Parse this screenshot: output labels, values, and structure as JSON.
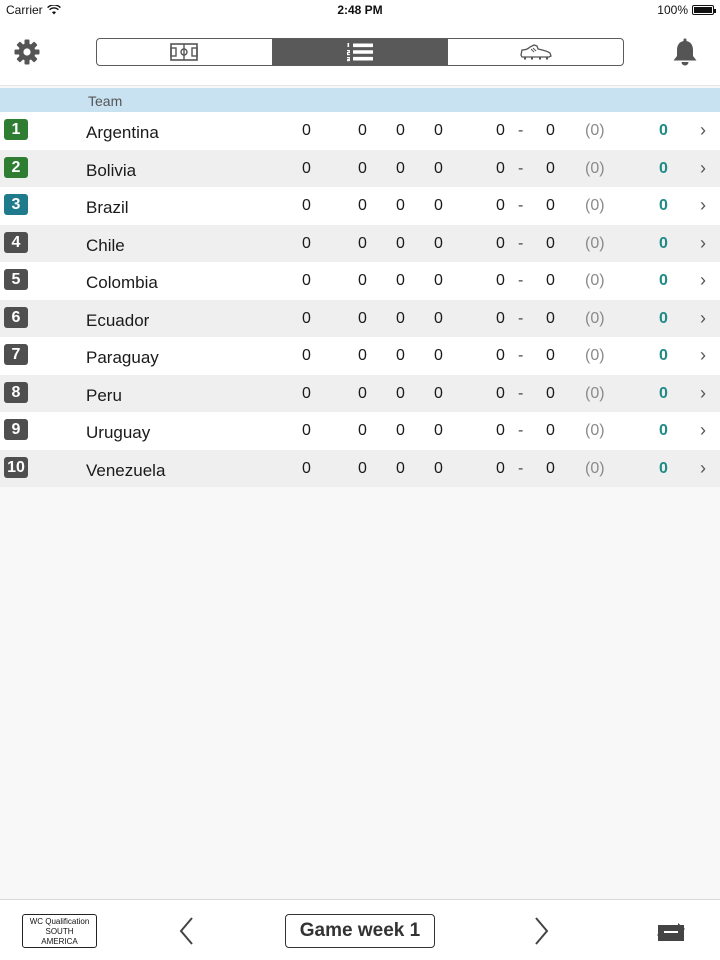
{
  "status_bar": {
    "carrier": "Carrier",
    "time": "2:48 PM",
    "battery": "100%"
  },
  "top_bar": {
    "settings_icon": "gear-icon",
    "notifications_icon": "bell-icon",
    "segments": [
      {
        "icon": "pitch-icon",
        "selected": false
      },
      {
        "icon": "ranked-list-icon",
        "selected": true
      },
      {
        "icon": "football-boot-icon",
        "selected": false
      }
    ]
  },
  "table": {
    "header_team": "Team",
    "rows": [
      {
        "rank": "1",
        "team": "Argentina",
        "played": "0",
        "won": "0",
        "drawn": "0",
        "lost": "0",
        "gf": "0",
        "dash": "-",
        "ga": "0",
        "gd": "(0)",
        "points": "0"
      },
      {
        "rank": "2",
        "team": "Bolivia",
        "played": "0",
        "won": "0",
        "drawn": "0",
        "lost": "0",
        "gf": "0",
        "dash": "-",
        "ga": "0",
        "gd": "(0)",
        "points": "0"
      },
      {
        "rank": "3",
        "team": "Brazil",
        "played": "0",
        "won": "0",
        "drawn": "0",
        "lost": "0",
        "gf": "0",
        "dash": "-",
        "ga": "0",
        "gd": "(0)",
        "points": "0"
      },
      {
        "rank": "4",
        "team": "Chile",
        "played": "0",
        "won": "0",
        "drawn": "0",
        "lost": "0",
        "gf": "0",
        "dash": "-",
        "ga": "0",
        "gd": "(0)",
        "points": "0"
      },
      {
        "rank": "5",
        "team": "Colombia",
        "played": "0",
        "won": "0",
        "drawn": "0",
        "lost": "0",
        "gf": "0",
        "dash": "-",
        "ga": "0",
        "gd": "(0)",
        "points": "0"
      },
      {
        "rank": "6",
        "team": "Ecuador",
        "played": "0",
        "won": "0",
        "drawn": "0",
        "lost": "0",
        "gf": "0",
        "dash": "-",
        "ga": "0",
        "gd": "(0)",
        "points": "0"
      },
      {
        "rank": "7",
        "team": "Paraguay",
        "played": "0",
        "won": "0",
        "drawn": "0",
        "lost": "0",
        "gf": "0",
        "dash": "-",
        "ga": "0",
        "gd": "(0)",
        "points": "0"
      },
      {
        "rank": "8",
        "team": "Peru",
        "played": "0",
        "won": "0",
        "drawn": "0",
        "lost": "0",
        "gf": "0",
        "dash": "-",
        "ga": "0",
        "gd": "(0)",
        "points": "0"
      },
      {
        "rank": "9",
        "team": "Uruguay",
        "played": "0",
        "won": "0",
        "drawn": "0",
        "lost": "0",
        "gf": "0",
        "dash": "-",
        "ga": "0",
        "gd": "(0)",
        "points": "0"
      },
      {
        "rank": "10",
        "team": "Venezuela",
        "played": "0",
        "won": "0",
        "drawn": "0",
        "lost": "0",
        "gf": "0",
        "dash": "-",
        "ga": "0",
        "gd": "(0)",
        "points": "0"
      }
    ]
  },
  "colors": {
    "rank_green": "#2e7d32",
    "rank_teal": "#1f7a8c",
    "rank_gray": "#4f4f4f",
    "points_teal": "#1f8a86",
    "header_blue": "#c9e2f2",
    "segment_active": "#595959"
  },
  "rank_color_by_row": [
    "rank_green",
    "rank_green",
    "rank_teal",
    "rank_gray",
    "rank_gray",
    "rank_gray",
    "rank_gray",
    "rank_gray",
    "rank_gray",
    "rank_gray"
  ],
  "bottom_bar": {
    "competition_line1": "WC Qualification",
    "competition_line2": "SOUTH",
    "competition_line3": "AMERICA",
    "week_label": "Game week 1",
    "prev_icon": "chevron-left-icon",
    "next_icon": "chevron-right-icon",
    "swap_icon": "swap-arrows-icon"
  }
}
